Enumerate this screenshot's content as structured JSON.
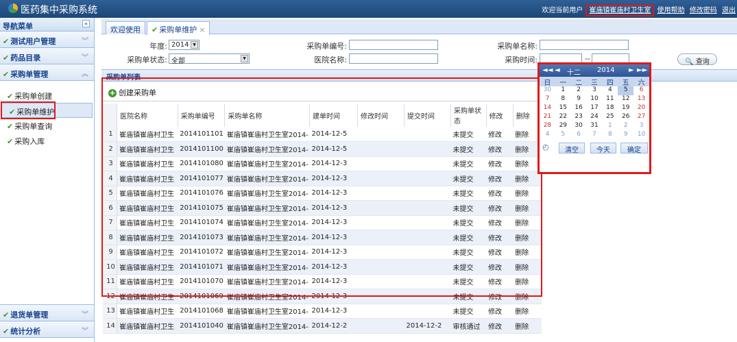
{
  "header": {
    "title": "医药集中采购系统",
    "welcome": "欢迎当前用户",
    "user": "崔庙镇崔庙村卫生室",
    "help": "使用帮助",
    "change_password": "修改密码",
    "logout": "退出"
  },
  "sidebar": {
    "title": "导航菜单",
    "collapse": "«",
    "sections": {
      "test_users": "测试用户管理",
      "drug_catalog": "药品目录",
      "purchase_mgmt": "采购单管理",
      "return_mgmt": "退货单管理",
      "statistics": "统计分析"
    },
    "items": [
      "采购单创建",
      "采购单维护",
      "采购单查询",
      "采购入库"
    ]
  },
  "tabs": [
    "欢迎使用",
    "采购单维护"
  ],
  "form": {
    "year_label": "年度:",
    "year_value": "2014",
    "order_no_label": "采购单编号:",
    "order_no_value": "",
    "order_name_label": "采购单名称:",
    "order_name_value": "",
    "status_label": "采购单状态:",
    "status_value": "全部",
    "hospital_label": "医院名称:",
    "hospital_value": "",
    "time_label": "采购时间:",
    "time_sep": "--",
    "query_button": "查询"
  },
  "list": {
    "title": "采购单列表",
    "create_button": "创建采购单",
    "columns": [
      "医院名称",
      "采购单编号",
      "采购单名称",
      "建单时间",
      "修改时间",
      "提交时间",
      "采购单状态",
      "修改",
      "删除"
    ],
    "rows": [
      {
        "n": "1",
        "hospital": "崔庙镇崔庙村卫生",
        "code": "2014101101",
        "name": "崔庙镇崔庙村卫生室2014-1",
        "created": "2014-12-5",
        "modified": "",
        "submitted": "",
        "status": "未提交",
        "edit": "修改",
        "del": "删除"
      },
      {
        "n": "2",
        "hospital": "崔庙镇崔庙村卫生",
        "code": "2014101100",
        "name": "崔庙镇崔庙村卫生室2014-1",
        "created": "2014-12-5",
        "modified": "",
        "submitted": "",
        "status": "未提交",
        "edit": "修改",
        "del": "删除"
      },
      {
        "n": "3",
        "hospital": "崔庙镇崔庙村卫生",
        "code": "2014101080",
        "name": "崔庙镇崔庙村卫生室2014-1",
        "created": "2014-12-3",
        "modified": "",
        "submitted": "",
        "status": "未提交",
        "edit": "修改",
        "del": "删除"
      },
      {
        "n": "4",
        "hospital": "崔庙镇崔庙村卫生",
        "code": "2014101077",
        "name": "崔庙镇崔庙村卫生室2014-1",
        "created": "2014-12-3",
        "modified": "",
        "submitted": "",
        "status": "未提交",
        "edit": "修改",
        "del": "删除"
      },
      {
        "n": "5",
        "hospital": "崔庙镇崔庙村卫生",
        "code": "2014101076",
        "name": "崔庙镇崔庙村卫生室2014-1",
        "created": "2014-12-3",
        "modified": "",
        "submitted": "",
        "status": "未提交",
        "edit": "修改",
        "del": "删除"
      },
      {
        "n": "6",
        "hospital": "崔庙镇崔庙村卫生",
        "code": "2014101075",
        "name": "崔庙镇崔庙村卫生室2014-1",
        "created": "2014-12-3",
        "modified": "",
        "submitted": "",
        "status": "未提交",
        "edit": "修改",
        "del": "删除"
      },
      {
        "n": "7",
        "hospital": "崔庙镇崔庙村卫生",
        "code": "2014101074",
        "name": "崔庙镇崔庙村卫生室2014-1",
        "created": "2014-12-3",
        "modified": "",
        "submitted": "",
        "status": "未提交",
        "edit": "修改",
        "del": "删除"
      },
      {
        "n": "8",
        "hospital": "崔庙镇崔庙村卫生",
        "code": "2014101073",
        "name": "崔庙镇崔庙村卫生室2014-1",
        "created": "2014-12-3",
        "modified": "",
        "submitted": "",
        "status": "未提交",
        "edit": "修改",
        "del": "删除"
      },
      {
        "n": "9",
        "hospital": "崔庙镇崔庙村卫生",
        "code": "2014101072",
        "name": "崔庙镇崔庙村卫生室2014-1",
        "created": "2014-12-3",
        "modified": "",
        "submitted": "",
        "status": "未提交",
        "edit": "修改",
        "del": "删除"
      },
      {
        "n": "10",
        "hospital": "崔庙镇崔庙村卫生",
        "code": "2014101071",
        "name": "崔庙镇崔庙村卫生室2014-1",
        "created": "2014-12-3",
        "modified": "",
        "submitted": "",
        "status": "未提交",
        "edit": "修改",
        "del": "删除"
      },
      {
        "n": "11",
        "hospital": "崔庙镇崔庙村卫生",
        "code": "2014101070",
        "name": "崔庙镇崔庙村卫生室2014-1",
        "created": "2014-12-3",
        "modified": "",
        "submitted": "",
        "status": "未提交",
        "edit": "修改",
        "del": "删除"
      },
      {
        "n": "12",
        "hospital": "崔庙镇崔庙村卫生",
        "code": "2014101069",
        "name": "崔庙镇崔庙村卫生室2014-1",
        "created": "2014-12-3",
        "modified": "",
        "submitted": "",
        "status": "未提交",
        "edit": "修改",
        "del": "删除"
      },
      {
        "n": "13",
        "hospital": "崔庙镇崔庙村卫生",
        "code": "2014101068",
        "name": "崔庙镇崔庙村卫生室2014-1",
        "created": "2014-12-3",
        "modified": "",
        "submitted": "",
        "status": "未提交",
        "edit": "修改",
        "del": "删除"
      },
      {
        "n": "14",
        "hospital": "崔庙镇崔庙村卫生",
        "code": "2014101040",
        "name": "崔庙镇崔庙村卫生室2014-1",
        "created": "2014-12-2",
        "modified": "",
        "submitted": "2014-12-2",
        "status": "审核通过",
        "edit": "修改",
        "del": "删除"
      }
    ]
  },
  "calendar": {
    "prev_year": "◄◄",
    "prev_month": "◄",
    "month": "十二",
    "year": "2014",
    "next_month": "►",
    "next_year": "►►",
    "weekdays": [
      "日",
      "一",
      "二",
      "三",
      "四",
      "五",
      "六"
    ],
    "weeks": [
      [
        "30",
        "1",
        "2",
        "3",
        "4",
        "5",
        "6"
      ],
      [
        "7",
        "8",
        "9",
        "10",
        "11",
        "12",
        "13"
      ],
      [
        "14",
        "15",
        "16",
        "17",
        "18",
        "19",
        "20"
      ],
      [
        "21",
        "22",
        "23",
        "24",
        "25",
        "26",
        "27"
      ],
      [
        "28",
        "29",
        "30",
        "31",
        "1",
        "2",
        "3"
      ],
      [
        "4",
        "5",
        "6",
        "7",
        "8",
        "9",
        "10"
      ]
    ],
    "clear": "清空",
    "today": "今天",
    "ok": "确定"
  }
}
